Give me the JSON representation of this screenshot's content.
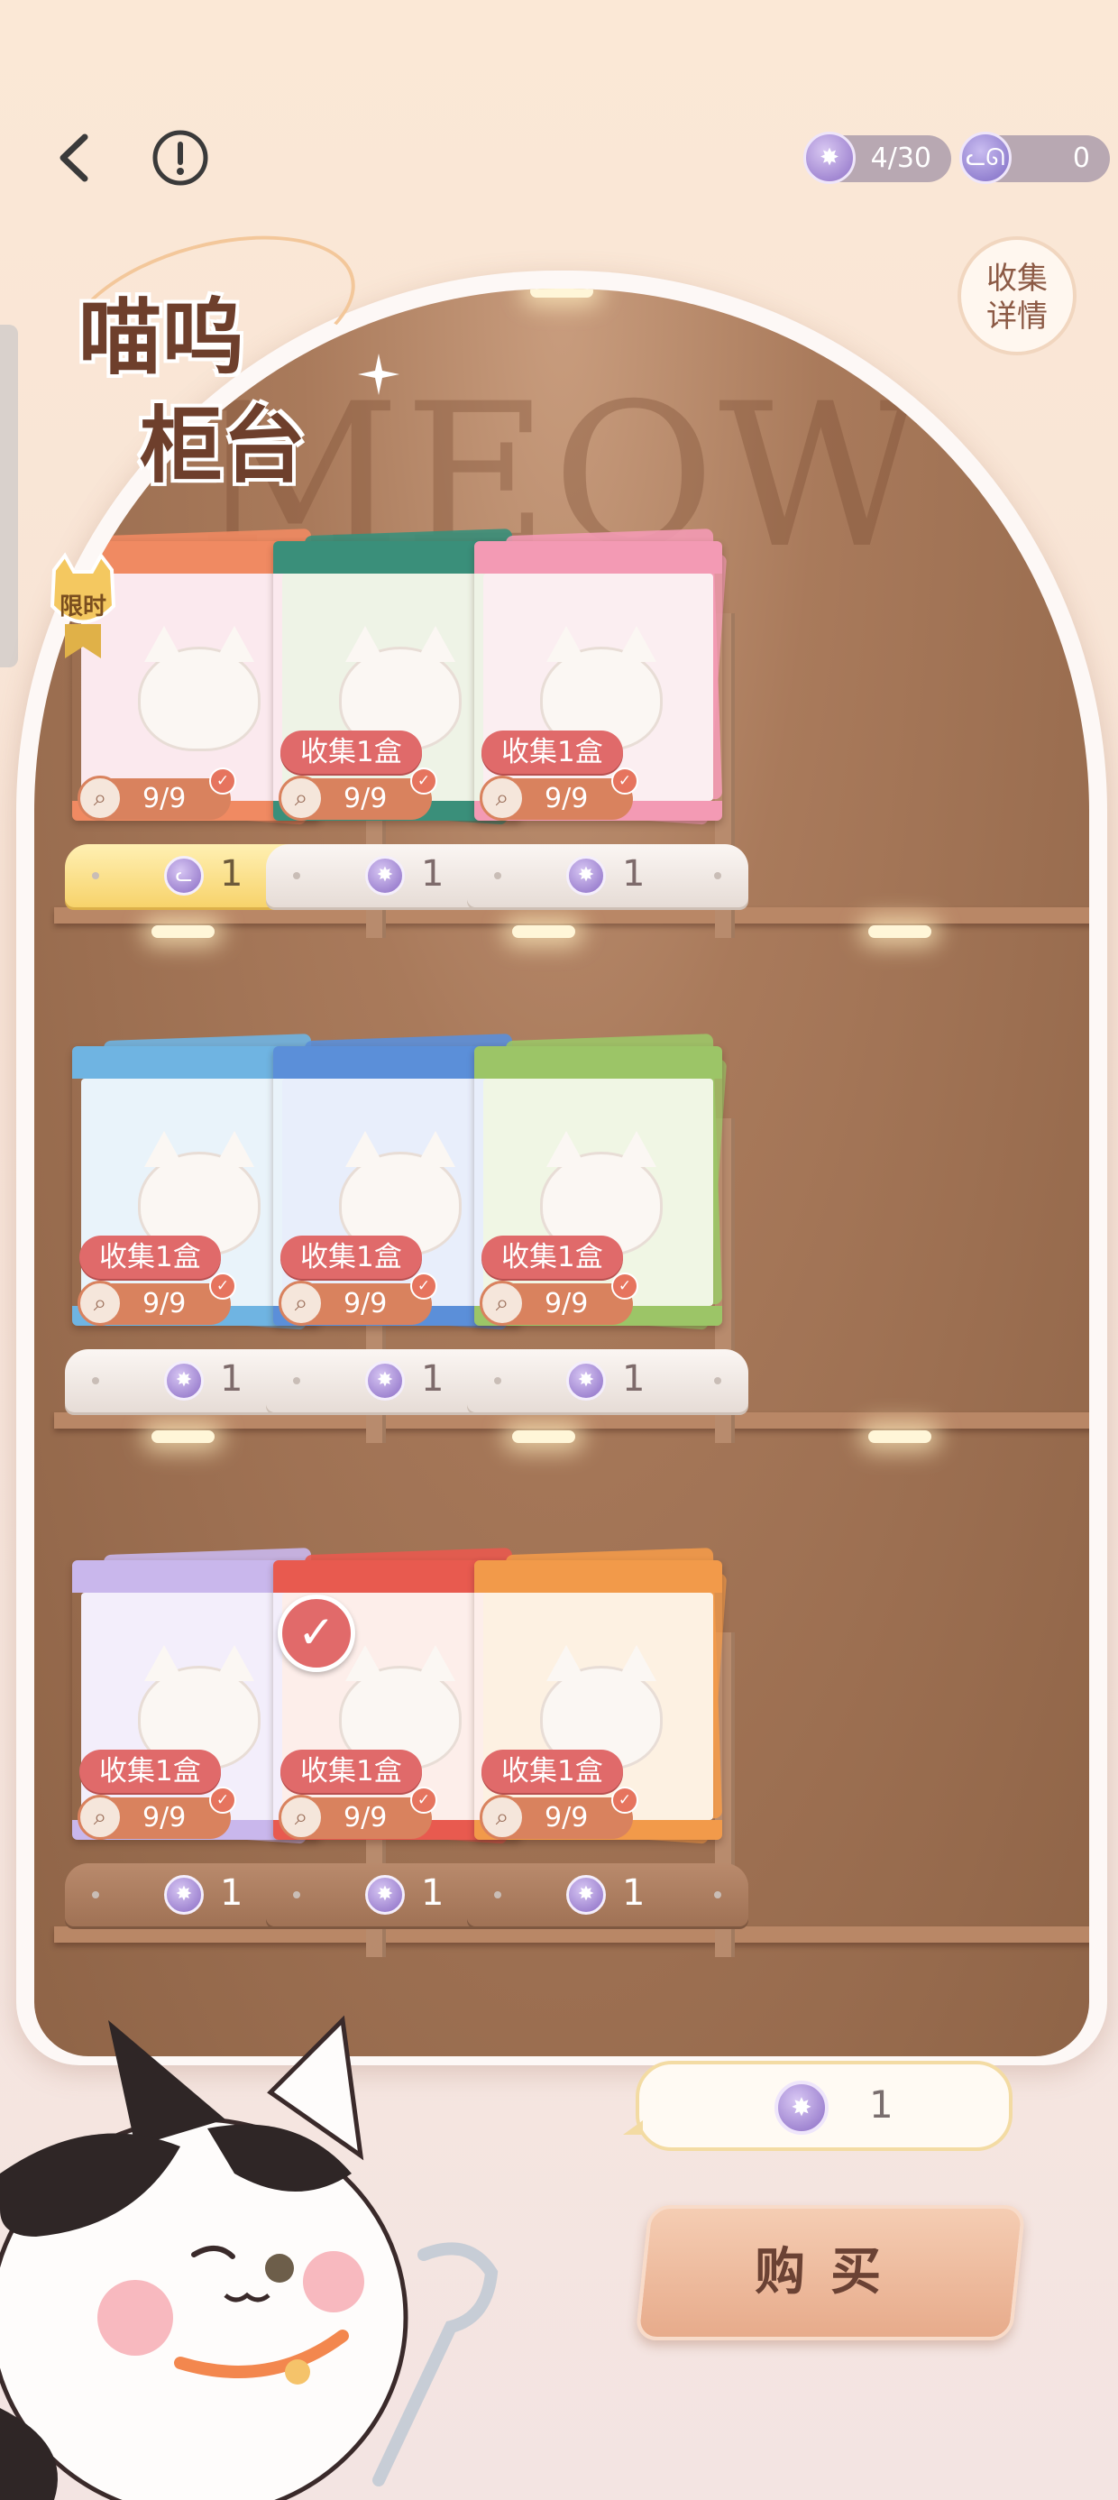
{
  "header": {
    "currency_star": "4/30",
    "currency_cat": "0"
  },
  "collect_details_label": "收集\n详情",
  "title": {
    "line1": "喵呜",
    "line2": "柜台"
  },
  "watermark": "MEOW",
  "limited_badge": "限时",
  "colors": {
    "accent": "#e06a6a",
    "progress": "#d9825e",
    "shelf": "#a97a5b"
  },
  "shelves": [
    {
      "items": [
        {
          "theme": "#f08a62",
          "art": "#fbe9ee",
          "tag": "",
          "progress": "9/9",
          "price": "1",
          "price_icon": "cat-coin-icon",
          "price_style": "gold",
          "limited": true
        },
        {
          "theme": "#3a8f7a",
          "art": "#eef3e6",
          "tag": "收集1盒",
          "progress": "9/9",
          "price": "1",
          "price_icon": "star-coin-icon",
          "price_style": "light"
        },
        {
          "theme": "#f39ab4",
          "art": "#fbeef1",
          "tag": "收集1盒",
          "progress": "9/9",
          "price": "1",
          "price_icon": "star-coin-icon",
          "price_style": "light"
        }
      ]
    },
    {
      "items": [
        {
          "theme": "#6fb4e2",
          "art": "#e9f3fa",
          "tag": "收集1盒",
          "progress": "9/9",
          "price": "1",
          "price_icon": "star-coin-icon",
          "price_style": "light"
        },
        {
          "theme": "#5b8fd9",
          "art": "#e8eefb",
          "tag": "收集1盒",
          "progress": "9/9",
          "price": "1",
          "price_icon": "star-coin-icon",
          "price_style": "light"
        },
        {
          "theme": "#9cc567",
          "art": "#f0f6e4",
          "tag": "收集1盒",
          "progress": "9/9",
          "price": "1",
          "price_icon": "star-coin-icon",
          "price_style": "light"
        }
      ]
    },
    {
      "items": [
        {
          "theme": "#c9b7ec",
          "art": "#f3eefb",
          "tag": "收集1盒",
          "progress": "9/9",
          "price": "1",
          "price_icon": "star-coin-icon",
          "price_style": "brown",
          "checked": true
        },
        {
          "theme": "#e85a4f",
          "art": "#fdeeea",
          "tag": "收集1盒",
          "progress": "9/9",
          "price": "1",
          "price_icon": "star-coin-icon",
          "price_style": "brown"
        },
        {
          "theme": "#f29a4a",
          "art": "#fdf1e2",
          "tag": "收集1盒",
          "progress": "9/9",
          "price": "1",
          "price_icon": "star-coin-icon",
          "price_style": "brown"
        }
      ]
    }
  ],
  "cost": "1",
  "buy_label": "购买"
}
